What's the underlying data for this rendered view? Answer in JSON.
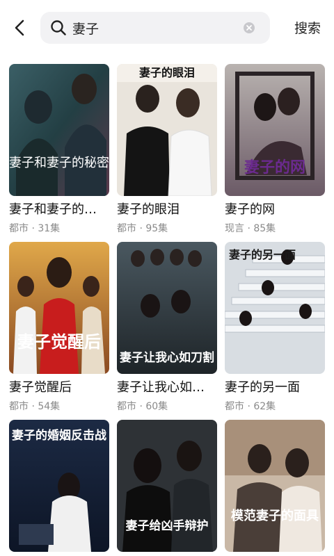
{
  "search": {
    "query": "妻子",
    "button_label": "搜索"
  },
  "colors": {
    "search_bg": "#f2f2f4",
    "text_primary": "#111111",
    "text_secondary": "#8a8a8a"
  },
  "results": [
    {
      "title": "妻子和妻子的…",
      "genre": "都市",
      "sep": "·",
      "episodes": "31集",
      "poster_text": "妻子和妻子的秘密"
    },
    {
      "title": "妻子的眼泪",
      "genre": "都市",
      "sep": "·",
      "episodes": "95集",
      "poster_text": "妻子的眼泪"
    },
    {
      "title": "妻子的网",
      "genre": "现言",
      "sep": "·",
      "episodes": "85集",
      "poster_text": "妻子的网"
    },
    {
      "title": "妻子觉醒后",
      "genre": "都市",
      "sep": "·",
      "episodes": "54集",
      "poster_text": "妻子觉醒后"
    },
    {
      "title": "妻子让我心如…",
      "genre": "都市",
      "sep": "·",
      "episodes": "60集",
      "poster_text": "妻子让我心如刀割"
    },
    {
      "title": "妻子的另一面",
      "genre": "都市",
      "sep": "·",
      "episodes": "62集",
      "poster_text": "妻子的另一面"
    },
    {
      "title": "",
      "genre": "",
      "sep": "",
      "episodes": "",
      "poster_text": "妻子的婚姻反击战"
    },
    {
      "title": "",
      "genre": "",
      "sep": "",
      "episodes": "",
      "poster_text": "妻子给凶手辩护"
    },
    {
      "title": "",
      "genre": "",
      "sep": "",
      "episodes": "",
      "poster_text": "模范妻子的面具"
    }
  ]
}
